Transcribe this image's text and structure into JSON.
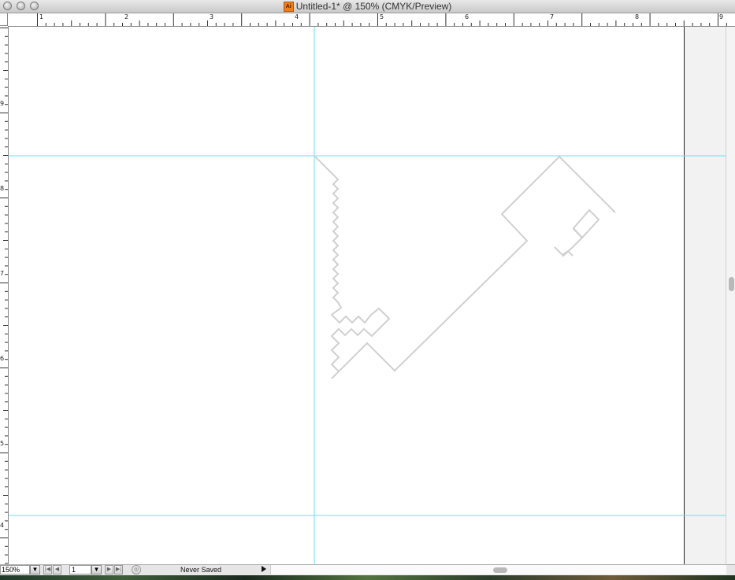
{
  "window": {
    "title": "Untitled-1* @ 150% (CMYK/Preview)",
    "app_icon": "Ai"
  },
  "rulers": {
    "top_labels": [
      "1",
      "2",
      "3",
      "4",
      "5",
      "6",
      "7",
      "8",
      "9"
    ],
    "left_labels": [
      "9",
      "8",
      "7",
      "6",
      "5",
      "4"
    ]
  },
  "status": {
    "zoom": "150%",
    "page": "1",
    "save_state": "Never Saved"
  },
  "colors": {
    "guide": "#5fe6f0",
    "artwork_stroke": "#d0d0d0",
    "artboard_edge": "#222222"
  }
}
